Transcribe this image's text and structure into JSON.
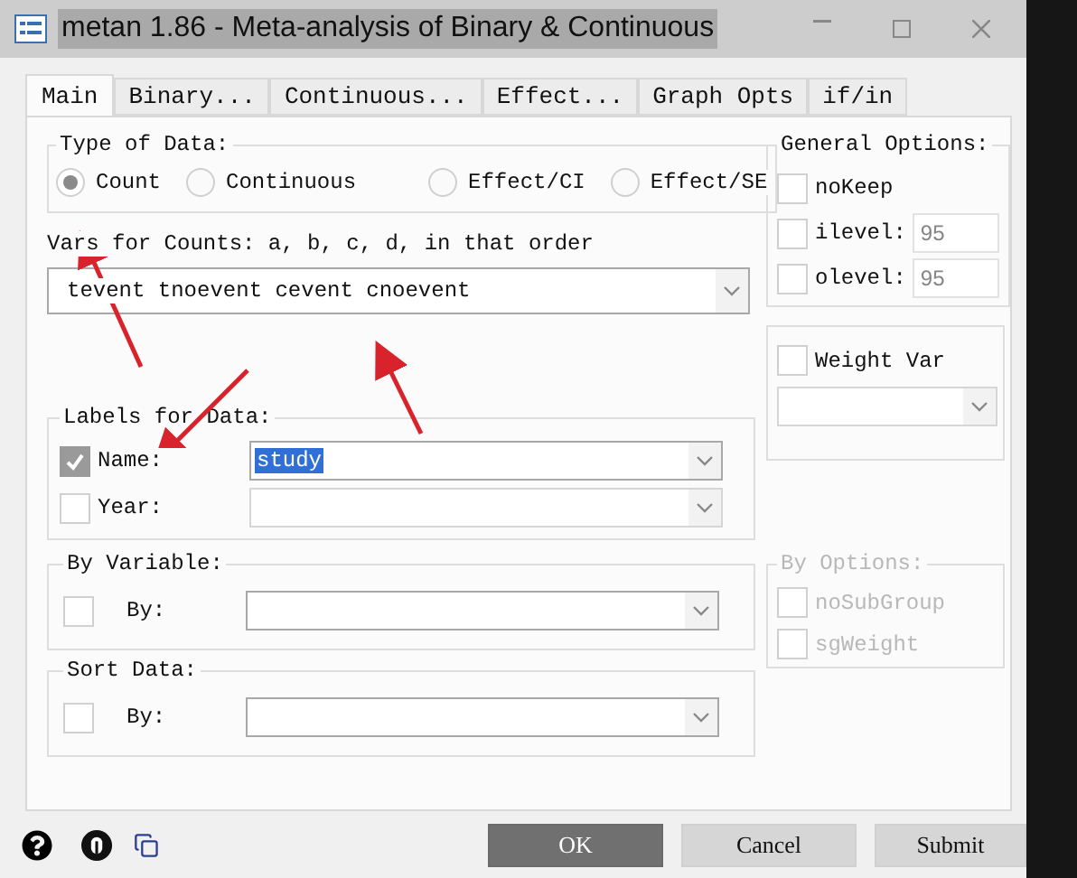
{
  "window": {
    "title": "metan 1.86 - Meta-analysis of Binary & Continuous"
  },
  "tabs": [
    {
      "label": "Main",
      "selected": true
    },
    {
      "label": "Binary...",
      "selected": false
    },
    {
      "label": "Continuous...",
      "selected": false
    },
    {
      "label": "Effect...",
      "selected": false
    },
    {
      "label": "Graph Opts",
      "selected": false
    },
    {
      "label": "if/in",
      "selected": false
    }
  ],
  "type_of_data": {
    "label": "Type of Data:",
    "options": [
      {
        "label": "Count",
        "selected": true
      },
      {
        "label": "Continuous",
        "selected": false
      },
      {
        "label": "Effect/CI",
        "selected": false
      },
      {
        "label": "Effect/SE",
        "selected": false
      }
    ]
  },
  "vars": {
    "label": "Vars for Counts: a, b, c, d, in that order",
    "value": "tevent tnoevent cevent cnoevent"
  },
  "labels_for_data": {
    "label": "Labels for Data:",
    "rows": [
      {
        "label": "Name:",
        "checked": true,
        "disabled": false,
        "value": "study",
        "highlighted": true
      },
      {
        "label": "Year:",
        "checked": false,
        "disabled": true
      }
    ]
  },
  "by_variable": {
    "label": "By Variable:",
    "row": {
      "label": "By:",
      "checked": false
    }
  },
  "sort_data": {
    "label": "Sort Data:",
    "row": {
      "label": "By:",
      "checked": false
    }
  },
  "general_options": {
    "label": "General Options:",
    "items": [
      {
        "kind": "checkbox",
        "label": "noKeep",
        "checked": false
      },
      {
        "kind": "checkbox-field",
        "label": "ilevel:",
        "checked": false,
        "value": "95"
      },
      {
        "kind": "checkbox-field",
        "label": "olevel:",
        "checked": false,
        "value": "95"
      }
    ]
  },
  "weight_var": {
    "label": "Weight Var",
    "checked": false
  },
  "by_options": {
    "label": "By Options:",
    "disabled": true,
    "items": [
      {
        "label": "noSubGroup",
        "checked": false
      },
      {
        "label": "sgWeight",
        "checked": false
      }
    ]
  },
  "buttons": [
    {
      "label": "OK",
      "default": true
    },
    {
      "label": "Cancel",
      "default": false
    },
    {
      "label": "Submit",
      "default": false
    }
  ]
}
